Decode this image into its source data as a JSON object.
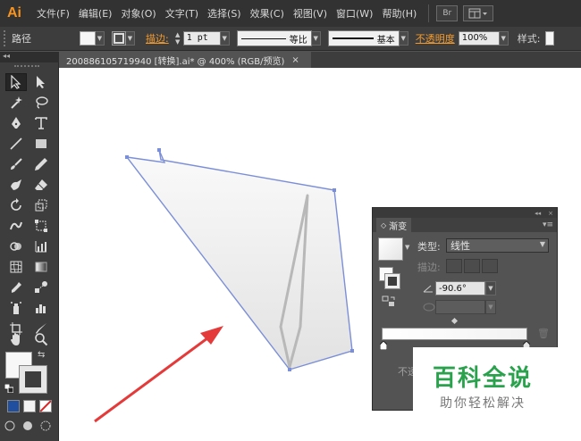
{
  "app": {
    "logo": "Ai"
  },
  "menu": [
    "文件(F)",
    "编辑(E)",
    "对象(O)",
    "文字(T)",
    "选择(S)",
    "效果(C)",
    "视图(V)",
    "窗口(W)",
    "帮助(H)"
  ],
  "menu_buttons": {
    "bridge": "Br"
  },
  "control_bar": {
    "selection_label": "路径",
    "stroke_label": "描边:",
    "stroke_weight": "1 pt",
    "profile_label": "等比",
    "brush_label": "基本",
    "opacity_label": "不透明度",
    "opacity_value": "100%",
    "style_label": "样式:"
  },
  "document_tab": {
    "title": "200886105719940 [转换].ai* @ 400% (RGB/预览)",
    "close": "×"
  },
  "tool_panel": {
    "collapse": "◂◂"
  },
  "gradient_panel": {
    "collapse": "◂◂",
    "close": "×",
    "tab_label": "渐变",
    "menu": "▾≡",
    "type_label": "类型:",
    "type_value": "线性",
    "stroke_label": "描边:",
    "angle_value": "-90.6°",
    "opacity_text": "不透"
  },
  "watermark": {
    "title": "百科全说",
    "subtitle": "助你轻松解决"
  },
  "colors": {
    "accent": "#f7931e",
    "path_stroke": "#7b8fd8",
    "arrow": "#e53a3a",
    "watermark_green": "#2aa24d",
    "ui_dark": "#323232",
    "ui_mid": "#535353"
  },
  "icons": [
    "selection-tool-icon",
    "direct-selection-tool-icon",
    "magic-wand-icon",
    "lasso-icon",
    "pen-tool-icon",
    "type-tool-icon",
    "line-tool-icon",
    "rectangle-tool-icon",
    "paintbrush-icon",
    "pencil-icon",
    "blob-brush-icon",
    "eraser-icon",
    "rotate-icon",
    "scale-icon",
    "warp-icon",
    "free-transform-icon",
    "shape-builder-icon",
    "graph-icon",
    "mesh-icon",
    "gradient-tool-icon",
    "eyedropper-icon",
    "blend-icon",
    "symbol-sprayer-icon",
    "column-graph-icon",
    "artboard-icon",
    "slice-icon",
    "hand-icon",
    "zoom-icon"
  ]
}
